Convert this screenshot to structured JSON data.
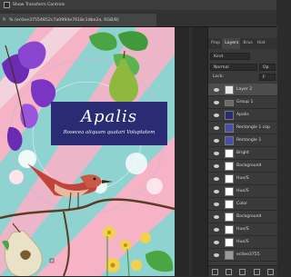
{
  "options_bar": {
    "show_transform_label": "Show Transform Controls"
  },
  "document": {
    "tab_title": "% (ec0ee37554852c7a0994e7618c1dbe2a, RGB/8)",
    "close_glyph": "×"
  },
  "artwork": {
    "title": "Apalis",
    "subtitle": "Rosecea aliquam quatari Voluptatem"
  },
  "panel": {
    "tabs": [
      "Prop",
      "Layers",
      "Brus",
      "Hist"
    ],
    "active_tab": "Layers",
    "kind_label": "Kind",
    "blend_mode": "Normal",
    "opacity_label": "Op",
    "lock_label": "Lock:",
    "fill_label": "F"
  },
  "layers": [
    {
      "name": "Layer 2",
      "selected": true,
      "thumb": "#e8e8e8"
    },
    {
      "name": "Group 1",
      "selected": false,
      "thumb": ""
    },
    {
      "name": "Apalis",
      "selected": false,
      "thumb": "#2a2c73"
    },
    {
      "name": "Rectangle 1 cop",
      "selected": false,
      "thumb": "#4a4ea8"
    },
    {
      "name": "Rectangle 1",
      "selected": false,
      "thumb": "#4a4ea8"
    },
    {
      "name": "Bright",
      "selected": false,
      "thumb": "#ffffff"
    },
    {
      "name": "Background",
      "selected": false,
      "thumb": "#ffffff"
    },
    {
      "name": "Hue/S",
      "selected": false,
      "thumb": "#ffffff"
    },
    {
      "name": "Hue/S",
      "selected": false,
      "thumb": "#ffffff"
    },
    {
      "name": "Color",
      "selected": false,
      "thumb": "#ffffff"
    },
    {
      "name": "Background",
      "selected": false,
      "thumb": "#ffffff"
    },
    {
      "name": "Hue/S",
      "selected": false,
      "thumb": "#ffffff"
    },
    {
      "name": "Hue/S",
      "selected": false,
      "thumb": "#ffffff"
    },
    {
      "name": "ec0ee3755",
      "selected": false,
      "thumb": "#9a9a9a"
    }
  ],
  "colors": {
    "accent_blue": "#2a2c73",
    "panel_bg": "#3a3a3a",
    "pink": "#f5a3b8",
    "teal": "#7fc9c7"
  }
}
